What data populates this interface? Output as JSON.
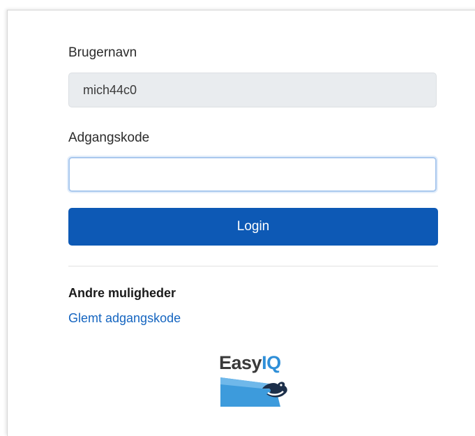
{
  "form": {
    "username_label": "Brugernavn",
    "username_value": "mich44c0",
    "password_label": "Adgangskode",
    "password_value": "",
    "login_label": "Login"
  },
  "other": {
    "heading": "Andre muligheder",
    "forgot_link": "Glemt adgangskode"
  },
  "logo": {
    "part1": "Easy",
    "part2": "IQ",
    "icon": "easyiq-logo"
  },
  "colors": {
    "primary_button": "#0d59b5",
    "link": "#1565c0",
    "logo_blue": "#2f8fd8",
    "readonly_field": "#e9ecef"
  }
}
